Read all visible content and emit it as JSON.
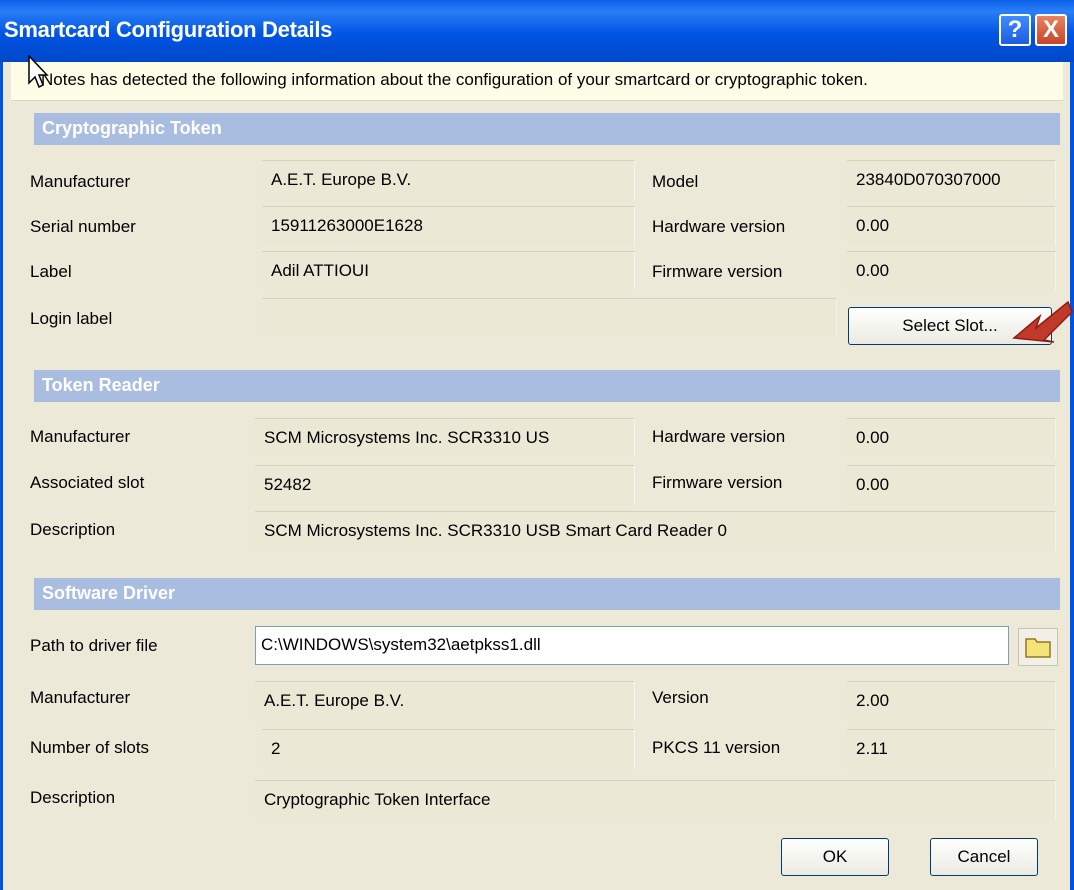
{
  "window": {
    "title": "Smartcard Configuration Details",
    "help_glyph": "?",
    "close_glyph": "X"
  },
  "info_text": "Notes has detected the following information about the configuration of your smartcard or cryptographic token.",
  "crypto": {
    "header": "Cryptographic Token",
    "manufacturer_label": "Manufacturer",
    "manufacturer": "A.E.T. Europe B.V.",
    "serial_label": "Serial number",
    "serial": "15911263000E1628",
    "label_label": "Label",
    "label": "Adil  ATTIOUI",
    "login_label": "Login label",
    "login": "",
    "model_label": "Model",
    "model": "23840D070307000",
    "hw_label": "Hardware version",
    "hw": "0.00",
    "fw_label": "Firmware version",
    "fw": "0.00",
    "select_slot": "Select Slot..."
  },
  "reader": {
    "header": "Token Reader",
    "manufacturer_label": "Manufacturer",
    "manufacturer": "SCM Microsystems Inc. SCR3310 US",
    "slot_label": "Associated slot",
    "slot": "52482",
    "desc_label": "Description",
    "desc": "SCM Microsystems Inc. SCR3310 USB Smart Card Reader 0",
    "hw_label": "Hardware version",
    "hw": "0.00",
    "fw_label": "Firmware version",
    "fw": "0.00"
  },
  "driver": {
    "header": "Software Driver",
    "path_label": "Path to driver file",
    "path": "C:\\WINDOWS\\system32\\aetpkss1.dll",
    "manufacturer_label": "Manufacturer",
    "manufacturer": "A.E.T. Europe B.V.",
    "slots_label": "Number of slots",
    "slots": "2",
    "desc_label": "Description",
    "desc": "Cryptographic Token Interface",
    "version_label": "Version",
    "version": "2.00",
    "pkcs_label": "PKCS 11 version",
    "pkcs": "2.11"
  },
  "buttons": {
    "ok": "OK",
    "cancel": "Cancel"
  },
  "icons": {
    "help": "help-icon",
    "close": "close-icon",
    "folder": "folder-icon",
    "cursor": "mouse-cursor-icon",
    "arrow": "red-arrow-icon"
  },
  "colors": {
    "titlebar": "#0054e3",
    "section": "#a9bde0",
    "dialog": "#ece9d8",
    "arrow": "#c0392b"
  }
}
